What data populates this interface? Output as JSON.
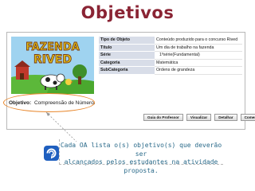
{
  "slide": {
    "title": "Objetivos",
    "caption_line1": "Cada OA lista o(s) objetivo(s) que deverão ser",
    "caption_line2": "alcançados pelos estudantes na atividade proposta."
  },
  "logo": {
    "line1": "FAZENDA",
    "line2": "RIVED"
  },
  "info_table": {
    "rows": [
      {
        "label": "Tipo de Objeto",
        "value": "Conteúdo produzido para o concurso Rived"
      },
      {
        "label": "Título",
        "value": "Um dia de trabalho na fazenda"
      },
      {
        "label": "Série",
        "value": "1ºsérie(Fundamental)"
      },
      {
        "label": "Categoria",
        "value": "Matemática"
      },
      {
        "label": "SubCategoria",
        "value": "Ordens de grandeza"
      }
    ]
  },
  "objective": {
    "label": "Objetivo:",
    "value": "Compreensão de Número."
  },
  "buttons": {
    "guide": "Guia do Professor",
    "view": "Visualizar",
    "detail": "Detalhar",
    "comment": "Comentar"
  },
  "colors": {
    "title": "#8a2434",
    "highlight": "#e8862a",
    "caption": "#2a6a8a",
    "table_label_bg": "#d8dde8"
  },
  "icons": {
    "nav": "swirl-arrow-icon"
  }
}
